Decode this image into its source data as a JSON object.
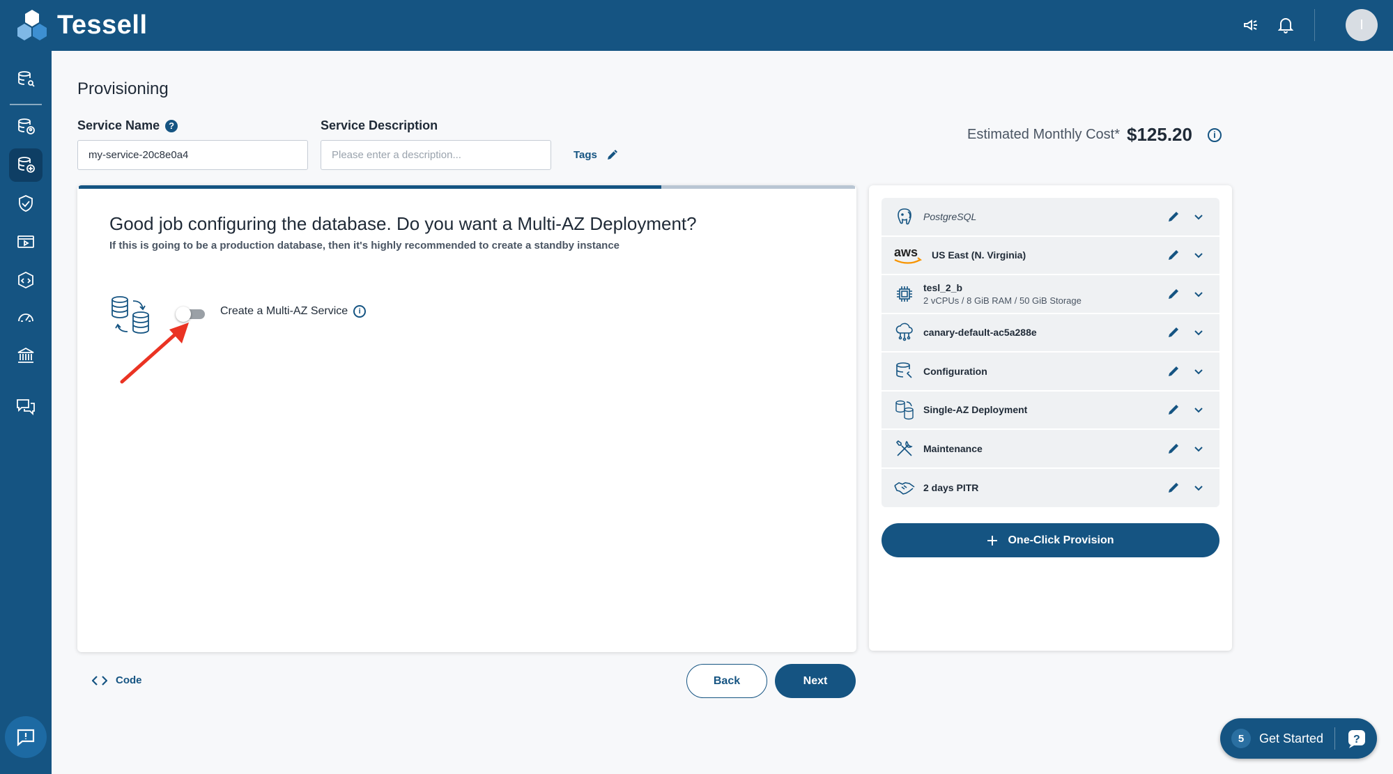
{
  "app": {
    "name": "Tessell"
  },
  "header": {
    "avatar_initial": "I"
  },
  "page": {
    "title": "Provisioning"
  },
  "form": {
    "service_name_label": "Service Name",
    "service_name_value": "my-service-20c8e0a4",
    "service_description_label": "Service Description",
    "service_description_placeholder": "Please enter a description...",
    "tags_label": "Tags"
  },
  "cost": {
    "label": "Estimated Monthly Cost*",
    "value": "$125.20"
  },
  "wizard": {
    "progress_fraction": 0.75,
    "title": "Good job configuring the database. Do you want a Multi-AZ Deployment?",
    "subtitle": "If this is going to be a production database, then it's highly recommended to create a standby instance",
    "toggle_label": "Create a Multi-AZ Service",
    "toggle_on": false
  },
  "summary": {
    "items": [
      {
        "icon": "postgresql-icon",
        "label": "PostgreSQL",
        "sub": ""
      },
      {
        "icon": "aws-icon",
        "label": "US East (N. Virginia)",
        "sub": ""
      },
      {
        "icon": "chip-icon",
        "label": "tesl_2_b",
        "sub": "2 vCPUs / 8 GiB RAM / 50 GiB Storage"
      },
      {
        "icon": "cloud-network-icon",
        "label": "canary-default-ac5a288e",
        "sub": ""
      },
      {
        "icon": "database-settings-icon",
        "label": "Configuration",
        "sub": ""
      },
      {
        "icon": "database-sync-icon",
        "label": "Single-AZ Deployment",
        "sub": ""
      },
      {
        "icon": "tools-icon",
        "label": "Maintenance",
        "sub": ""
      },
      {
        "icon": "handshake-icon",
        "label": "2 days PITR",
        "sub": ""
      }
    ],
    "one_click_label": "One-Click Provision"
  },
  "footer": {
    "code_label": "Code",
    "back_label": "Back",
    "next_label": "Next"
  },
  "get_started": {
    "count": "5",
    "label": "Get Started"
  },
  "colors": {
    "brand": "#155482",
    "accent_arrow": "#ea3323"
  }
}
